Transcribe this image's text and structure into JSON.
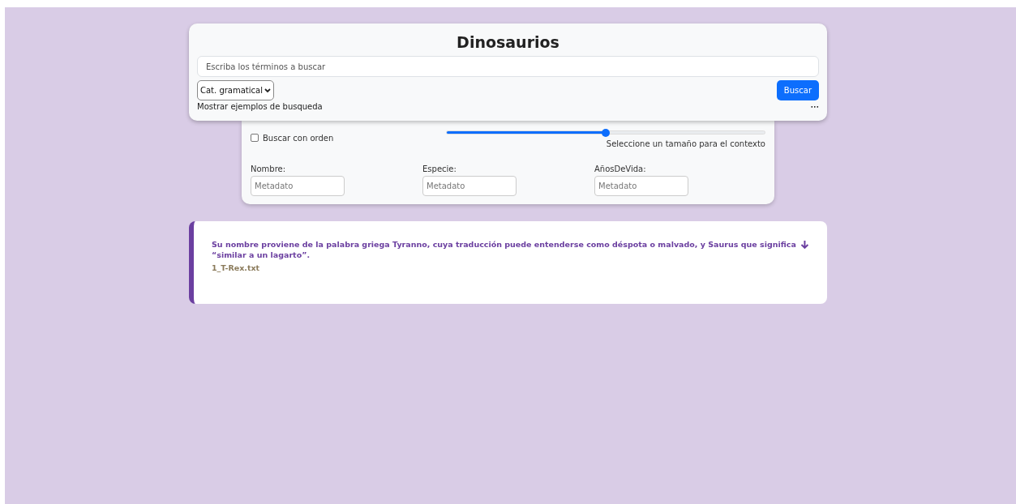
{
  "title": "Dinosaurios",
  "search": {
    "placeholder": "Escriba los términos a buscar"
  },
  "category_select": {
    "value": "Cat. gramatical"
  },
  "search_button": "Buscar",
  "examples_link": "Mostrar ejemplos de busqueda",
  "more_button": "•••",
  "options": {
    "order_checkbox": {
      "label": "Buscar con orden",
      "checked": false
    },
    "context_slider": {
      "level": 0.5,
      "label": "Seleccione un tamaño para el contexto"
    },
    "metadata_fields": [
      {
        "label": "Nombre:",
        "placeholder": "Metadato"
      },
      {
        "label": "Especie:",
        "placeholder": "Metadato"
      },
      {
        "label": "AñosDeVida:",
        "placeholder": "Metadato"
      }
    ]
  },
  "results": [
    {
      "text": "Su nombre proviene de la palabra griega Tyranno, cuya traducción puede entenderse como déspota o malvado, y Saurus que significa “similar a un lagarto”.",
      "file": "1_T-Rex.txt"
    }
  ]
}
